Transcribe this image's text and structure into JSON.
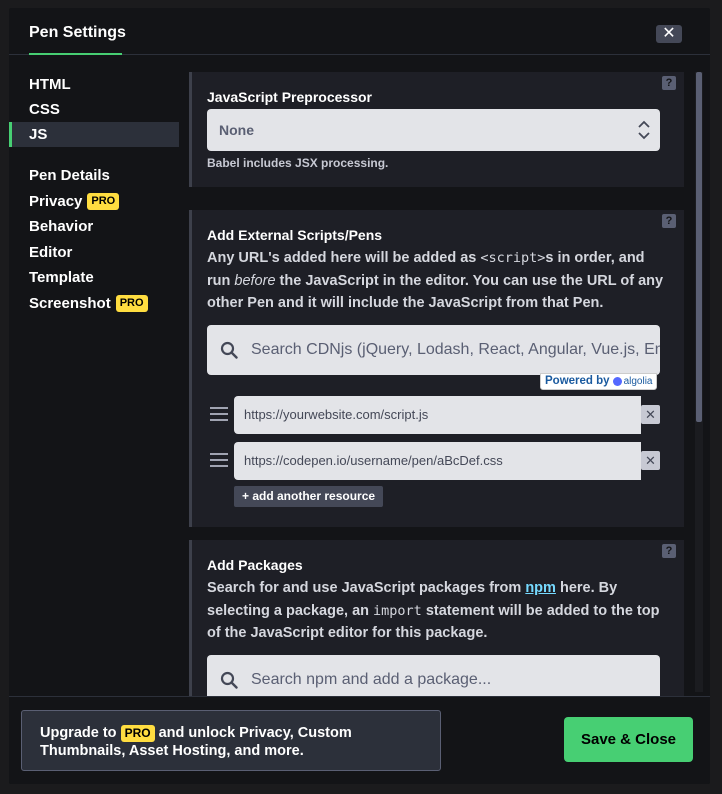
{
  "modal": {
    "title": "Pen Settings",
    "close_label": "✕"
  },
  "sidebar": {
    "group1": [
      {
        "label": "HTML",
        "active": false
      },
      {
        "label": "CSS",
        "active": false
      },
      {
        "label": "JS",
        "active": true
      }
    ],
    "group2": [
      {
        "label": "Pen Details",
        "pro": false
      },
      {
        "label": "Privacy",
        "pro": true
      },
      {
        "label": "Behavior",
        "pro": false
      },
      {
        "label": "Editor",
        "pro": false
      },
      {
        "label": "Template",
        "pro": false
      },
      {
        "label": "Screenshot",
        "pro": true
      }
    ],
    "pro_label": "PRO"
  },
  "preprocessor": {
    "title": "JavaScript Preprocessor",
    "selected": "None",
    "hint": "Babel includes JSX processing.",
    "help": "?"
  },
  "external": {
    "title": "Add External Scripts/Pens",
    "help": "?",
    "desc_part1": "Any URL's added here will be added as ",
    "desc_code": "<script>",
    "desc_part2": "s in order, and run ",
    "desc_em": "before",
    "desc_part3": " the JavaScript in the editor. You can use the URL of any other Pen and it will include the JavaScript from that Pen.",
    "search_placeholder": "Search CDNjs (jQuery, Lodash, React, Angular, Vue.js, Ember...",
    "powered_by": "Powered by",
    "algolia": "algolia",
    "resources": [
      {
        "placeholder": "https://yourwebsite.com/script.js"
      },
      {
        "placeholder": "https://codepen.io/username/pen/aBcDef.css"
      }
    ],
    "remove_label": "✕",
    "add_label": "+ add another resource"
  },
  "packages": {
    "title": "Add Packages",
    "help": "?",
    "desc_part1": "Search for and use JavaScript packages from ",
    "desc_link": "npm",
    "desc_part2": " here. By selecting a package, an ",
    "desc_code": "import",
    "desc_part3": " statement will be added to the top of the JavaScript editor for this package.",
    "search_placeholder": "Search npm and add a package..."
  },
  "footer": {
    "upgrade_prefix": "Upgrade to ",
    "upgrade_pro": "PRO",
    "upgrade_suffix": " and unlock Privacy, Custom Thumbnails, Asset Hosting, and more.",
    "save_label": "Save & Close"
  },
  "colors": {
    "accent": "#47cf73",
    "pro": "#ffdd40",
    "link": "#76daff"
  }
}
